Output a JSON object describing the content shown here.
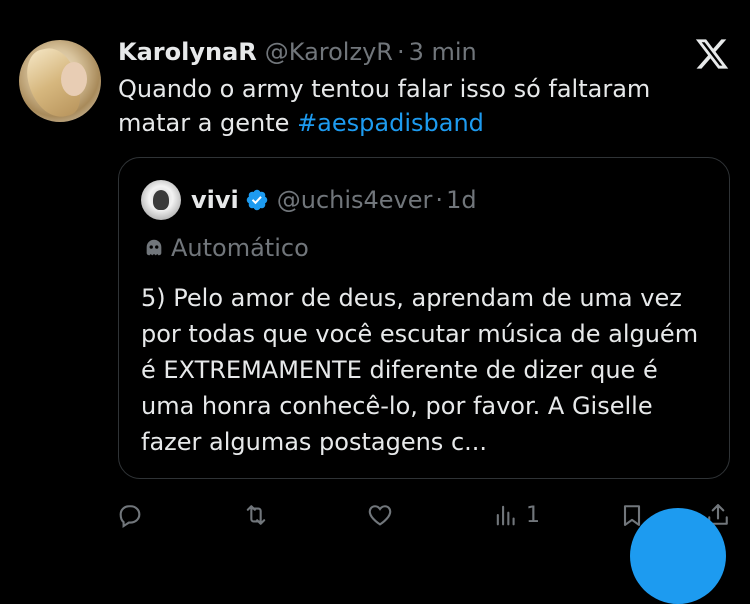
{
  "tweet": {
    "author_name": "KarolynaR",
    "author_handle": "@KarolzyR",
    "separator": "·",
    "time": "3 min",
    "text_main": "Quando o army tentou falar isso só faltaram matar a gente ",
    "hashtag": "#aespadisband"
  },
  "quote": {
    "author_name": "vivi",
    "author_handle": "@uchis4ever",
    "separator": "·",
    "time": "1d",
    "automated_label": "Automático",
    "text": "5) Pelo amor de deus, aprendam de uma vez por todas que você escutar música de alguém é EXTREMAMENTE diferente de dizer que é uma honra conhecê-lo, por favor. A Giselle fazer algumas postagens c..."
  },
  "actions": {
    "views_count": "1"
  },
  "icons": {
    "close": "x-logo-icon",
    "verified": "verified-badge-icon",
    "automated": "robot-icon",
    "reply": "reply-icon",
    "retweet": "retweet-icon",
    "like": "heart-icon",
    "views": "views-icon",
    "bookmark": "bookmark-icon",
    "share": "share-icon"
  },
  "colors": {
    "background": "#000000",
    "text": "#e7e9ea",
    "secondary": "#71767b",
    "accent": "#1d9bf0",
    "border": "#2f3336"
  }
}
